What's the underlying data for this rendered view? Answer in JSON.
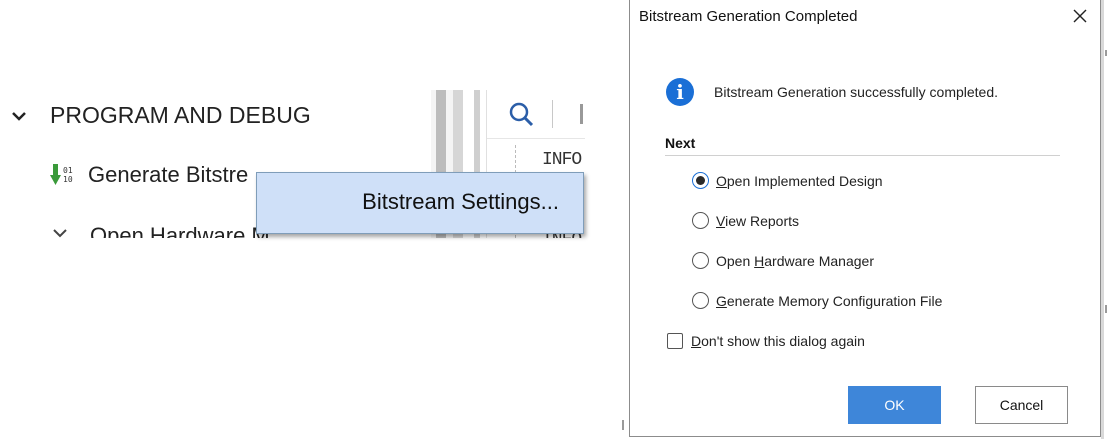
{
  "navigator": {
    "section_label": "PROGRAM AND DEBUG",
    "items": [
      {
        "label": "Generate Bitstre",
        "icon": "bitstream-icon"
      },
      {
        "label": "Open Hardware M",
        "icon": "hardware-icon"
      }
    ]
  },
  "log_pane": {
    "lines": [
      "INFO",
      "INFO"
    ]
  },
  "context_menu": {
    "item_label": "Bitstream Settings..."
  },
  "dialog": {
    "title": "Bitstream Generation Completed",
    "message": "Bitstream Generation successfully completed.",
    "next_label": "Next",
    "options": [
      {
        "pre": "",
        "mnemonic": "O",
        "post": "pen Implemented Design",
        "selected": true
      },
      {
        "pre": "",
        "mnemonic": "V",
        "post": "iew Reports",
        "selected": false
      },
      {
        "pre": "Open ",
        "mnemonic": "H",
        "post": "ardware Manager",
        "selected": false
      },
      {
        "pre": "",
        "mnemonic": "G",
        "post": "enerate Memory Configuration File",
        "selected": false
      }
    ],
    "checkbox": {
      "mnemonic": "D",
      "post": "on't show this dialog again",
      "checked": false
    },
    "ok_label": "OK",
    "cancel_label": "Cancel"
  },
  "colors": {
    "accent": "#3e86d9",
    "info_icon": "#1a6fd6",
    "menu_highlight": "#cfe0f8",
    "bitstream_icon": "#3a9a3a"
  }
}
